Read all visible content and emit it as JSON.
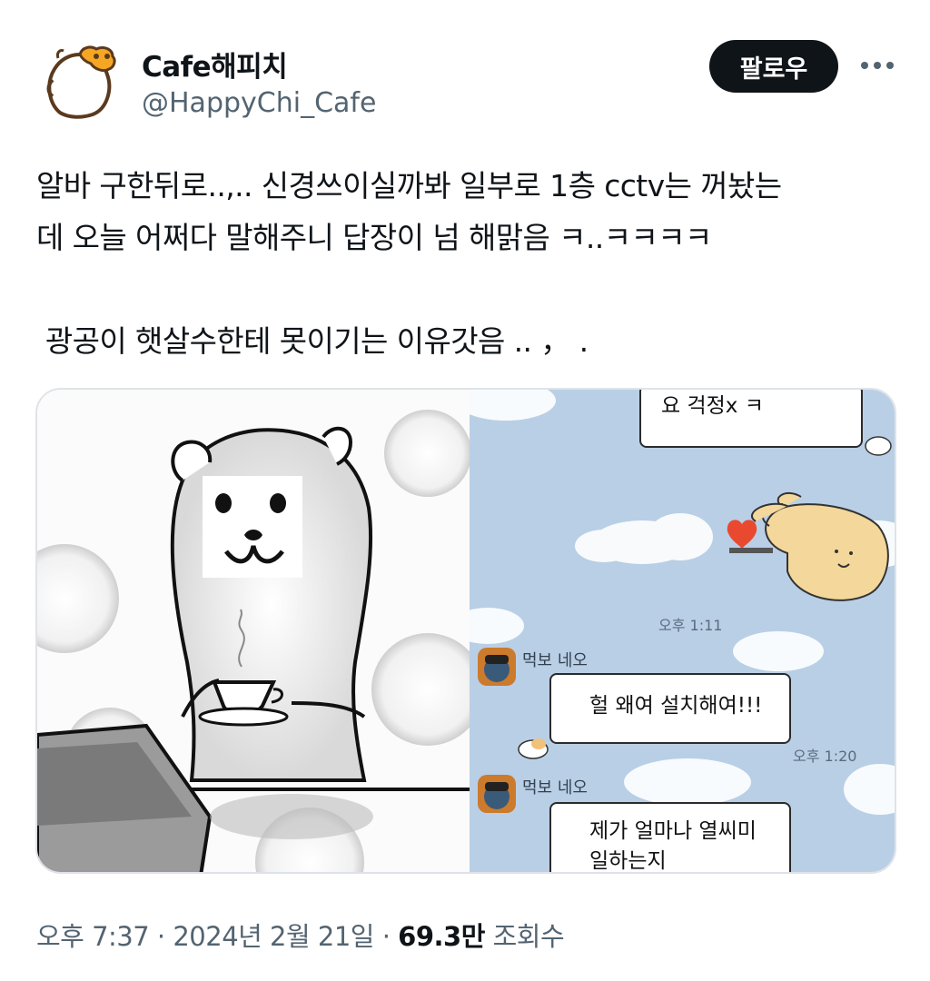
{
  "author": {
    "name": "Cafe해피치",
    "handle": "@HappyChi_Cafe",
    "avatar_icon": "hamster-logo-icon"
  },
  "actions": {
    "follow_label": "팔로우",
    "more_icon": "more-dots-icon"
  },
  "tweet": {
    "text": "알바 구한뒤로..,.. 신경쓰이실까봐 일부로 1층 cctv는 꺼놨는\n데 오늘 어쩌다 말해주니 답장이 넘 해맑음 ㅋ..ㅋㅋㅋㅋ\n\n 광공이 햇살수한테 못이기는 이유갓음 .. ， ."
  },
  "media": {
    "left_image": "bear-drinking-coffee-illustration",
    "chat": {
      "messages": [
        {
          "text": "요 걱정x ㅋ"
        },
        {
          "time": "오후 1:11"
        },
        {
          "sender": "먹보 네오",
          "text": "헐 왜여 설치해여!!!",
          "time": "오후 1:20"
        },
        {
          "sender": "먹보 네오",
          "text": "제가 얼마나 열씨미\n일하는지"
        }
      ]
    }
  },
  "meta": {
    "time": "오후 7:37",
    "sep1": " · ",
    "date": "2024년 2월 21일",
    "sep2": " · ",
    "views": "69.3만",
    "views_label": " 조회수"
  },
  "colors": {
    "follow_bg": "#0f1419",
    "handle": "#536471",
    "chat_bg": "#b9cfe6"
  }
}
